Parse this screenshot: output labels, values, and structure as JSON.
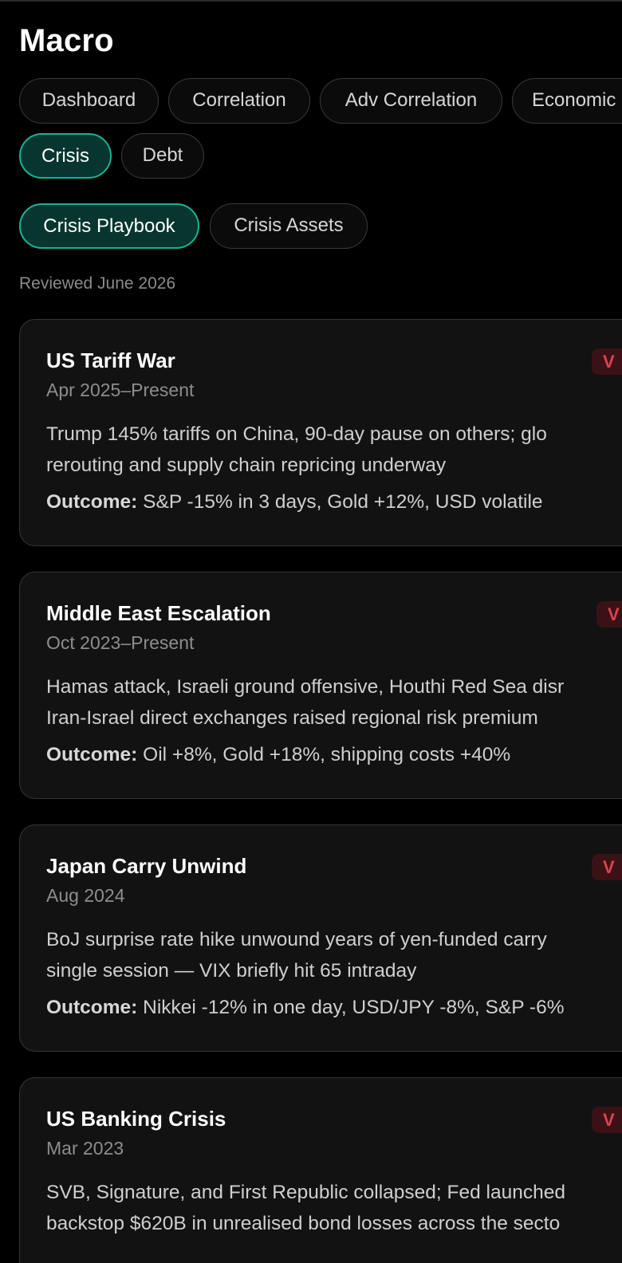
{
  "page": {
    "title": "Macro"
  },
  "tabs": {
    "row1": [
      "Dashboard",
      "Correlation",
      "Adv Correlation",
      "Economic"
    ],
    "row2": [
      "Crisis",
      "Debt"
    ],
    "active": "Crisis"
  },
  "subtabs": {
    "items": [
      "Crisis Playbook",
      "Crisis Assets"
    ],
    "active": "Crisis Playbook"
  },
  "reviewed": "Reviewed June 2026",
  "outcome_label": "Outcome:",
  "accent_color": "#1ab394",
  "badge_color": "#e0414f",
  "crises": [
    {
      "title": "US Tariff War",
      "date": "Apr 2025–Present",
      "badge": "V",
      "desc_line1": "Trump 145% tariffs on China, 90-day pause on others; glo",
      "desc_line2": "rerouting and supply chain repricing underway",
      "outcome": "S&P -15% in 3 days, Gold +12%, USD volatile"
    },
    {
      "title": "Middle East Escalation",
      "date": "Oct 2023–Present",
      "badge": "V",
      "desc_line1": "Hamas attack, Israeli ground offensive, Houthi Red Sea disr",
      "desc_line2": "Iran-Israel direct exchanges raised regional risk premium",
      "outcome": "Oil +8%, Gold +18%, shipping costs +40%"
    },
    {
      "title": "Japan Carry Unwind",
      "date": "Aug 2024",
      "badge": "V",
      "desc_line1": "BoJ surprise rate hike unwound years of yen-funded carry",
      "desc_line2": "single session — VIX briefly hit 65 intraday",
      "outcome": "Nikkei -12% in one day, USD/JPY -8%, S&P -6%"
    },
    {
      "title": "US Banking Crisis",
      "date": "Mar 2023",
      "badge": "V",
      "desc_line1": "SVB, Signature, and First Republic collapsed; Fed launched",
      "desc_line2": "backstop $620B in unrealised bond losses across the secto",
      "outcome": ""
    }
  ]
}
